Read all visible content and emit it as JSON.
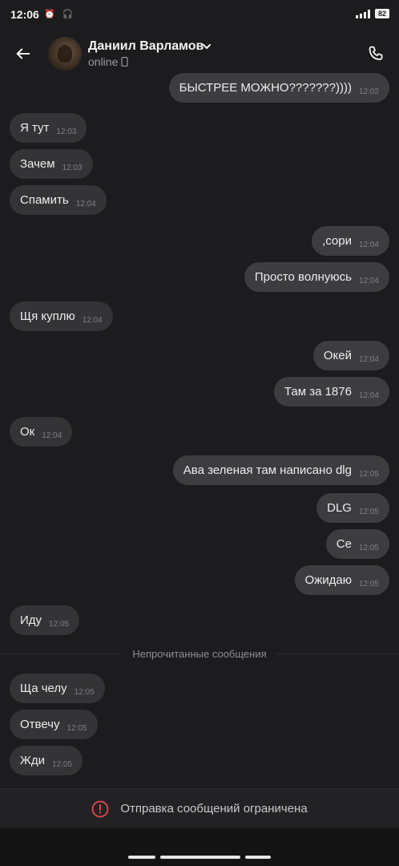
{
  "status_bar": {
    "time": "12:06",
    "icons_left": "⏰ 🎧",
    "battery": "82"
  },
  "header": {
    "name": "Даниил Варламов",
    "status": "online"
  },
  "messages": [
    {
      "dir": "out",
      "text": "БЫСТРЕЕ МОЖНО???????))))",
      "time": "12:02"
    },
    {
      "dir": "in",
      "text": "Я тут",
      "time": "12:03"
    },
    {
      "dir": "in",
      "text": "Зачем",
      "time": "12:03"
    },
    {
      "dir": "in",
      "text": "Спамить",
      "time": "12:04"
    },
    {
      "dir": "out",
      "text": ",сори",
      "time": "12:04"
    },
    {
      "dir": "out",
      "text": "Просто волнуюсь",
      "time": "12:04"
    },
    {
      "dir": "in",
      "text": "Щя куплю",
      "time": "12:04"
    },
    {
      "dir": "out",
      "text": "Окей",
      "time": "12:04"
    },
    {
      "dir": "out",
      "text": "Там за 1876",
      "time": "12:04"
    },
    {
      "dir": "in",
      "text": "Ок",
      "time": "12:04"
    },
    {
      "dir": "out",
      "text": "Ава зеленая там написано dlg",
      "time": "12:05"
    },
    {
      "dir": "out",
      "text": "DLG",
      "time": "12:05"
    },
    {
      "dir": "out",
      "text": "Се",
      "time": "12:05"
    },
    {
      "dir": "out",
      "text": "Ожидаю",
      "time": "12:05"
    },
    {
      "dir": "in",
      "text": "Иду",
      "time": "12:05"
    },
    {
      "dir": "in",
      "text": "Ща челу",
      "time": "12:05"
    },
    {
      "dir": "in",
      "text": "Отвечу",
      "time": "12:05"
    },
    {
      "dir": "in",
      "text": "Жди",
      "time": "12:05"
    }
  ],
  "unread_divider": "Непрочитанные сообщения",
  "footer": {
    "restricted_text": "Отправка сообщений ограничена",
    "icon": "alert-circle-icon"
  },
  "colors": {
    "background": "#1c1c1e",
    "bubble_in": "#343436",
    "bubble_out": "#3d3d40",
    "alert": "#e5484d"
  }
}
